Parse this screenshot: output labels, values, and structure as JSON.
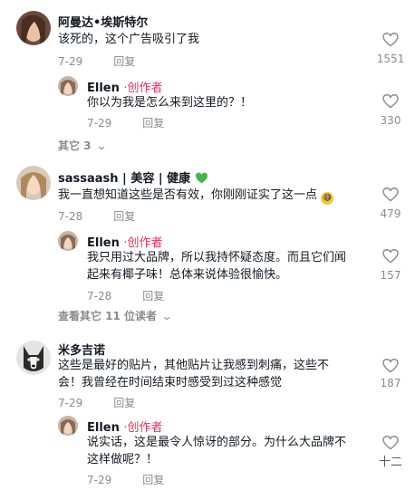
{
  "comments": [
    {
      "username": "阿曼达•埃斯特尔",
      "text": "该死的，这个广告吸引了我",
      "date": "7-29",
      "reply_label": "回复",
      "likes": "1551",
      "reply": {
        "username": "Ellen",
        "author_tag": "·创作者",
        "text": "你以为我是怎么来到这里的？！",
        "date": "7-29",
        "reply_label": "回复",
        "likes": "330"
      },
      "more_label": "其它 3"
    },
    {
      "username": "sassaash | 美容 | 健康",
      "text": "我一直想知道这些是否有效，你刚刚证实了这一点",
      "date": "7-28",
      "reply_label": "回复",
      "likes": "479",
      "reply": {
        "username": "Ellen",
        "author_tag": "·创作者",
        "text_line1": "我只用过大品牌，所以我持怀疑态度。而且它们闻",
        "text_line2": "起来有椰子味！总体来说体验很愉快。",
        "date": "7-28",
        "reply_label": "回复",
        "likes": "157"
      },
      "more_label": "查看其它 11 位读者"
    },
    {
      "username": "米多吉诺",
      "text_line1": "这些是最好的贴片，其他贴片让我感到刺痛，这些不",
      "text_line2": "会！我曾经在时间结束时感受到过这种感觉",
      "date": "7-29",
      "reply_label": "回复",
      "likes": "187",
      "reply": {
        "username": "Ellen",
        "author_tag": "·创作者",
        "text_line1": "说实话，这是最令人惊讶的部分。为什么大品牌不",
        "text_line2": "这样做呢？！",
        "date": "7-29",
        "reply_label": "回复",
        "likes": "十二"
      }
    }
  ],
  "colors": {
    "accent": "#fe2c55",
    "muted": "#8a8b91",
    "text": "#161823"
  }
}
